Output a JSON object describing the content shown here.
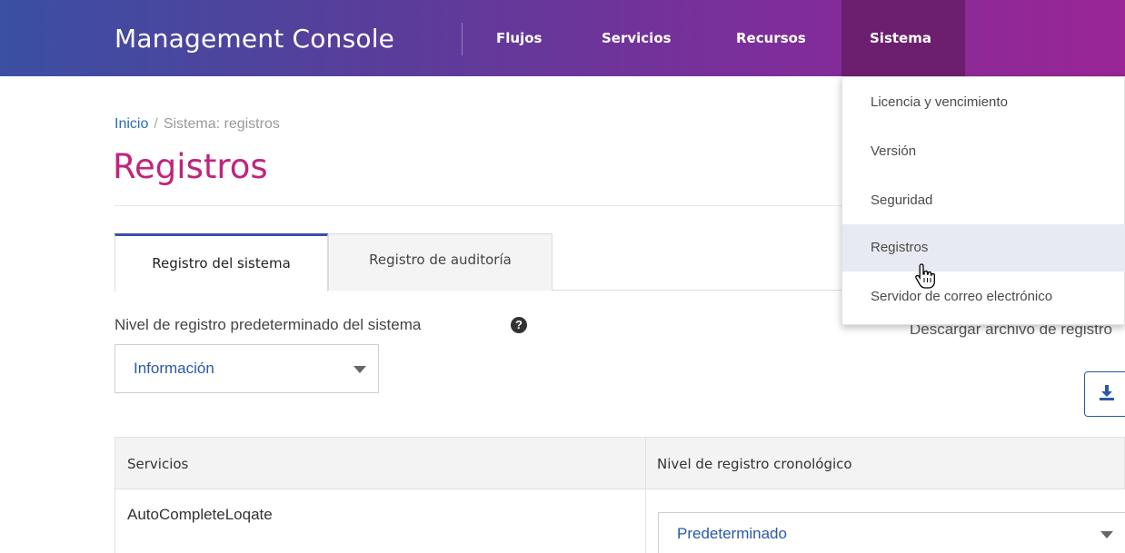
{
  "header": {
    "brand": "Management Console",
    "nav": {
      "flujos": "Flujos",
      "servicios": "Servicios",
      "recursos": "Recursos",
      "sistema": "Sistema"
    }
  },
  "dropdown": {
    "items": [
      {
        "label": "Licencia y vencimiento"
      },
      {
        "label": "Versión"
      },
      {
        "label": "Seguridad"
      },
      {
        "label": "Registros"
      },
      {
        "label": "Servidor de correo electrónico"
      }
    ],
    "active_item": "Registros"
  },
  "breadcrumb": {
    "home": "Inicio",
    "separator": "/",
    "current": "Sistema: registros"
  },
  "page": {
    "title": "Registros"
  },
  "tabs": {
    "system": "Registro del sistema",
    "audit": "Registro de auditoría"
  },
  "log_level": {
    "label": "Nivel de registro predeterminado del sistema",
    "help_icon": "question-circle-icon",
    "selected": "Información"
  },
  "download": {
    "label": "Descargar archivo de registro",
    "icon": "download-icon"
  },
  "table": {
    "headers": {
      "services": "Servicios",
      "level": "Nivel de registro cronológico"
    },
    "rows": [
      {
        "service": "AutoCompleteLoqate",
        "level": "Predeterminado"
      }
    ]
  },
  "colors": {
    "header_gradient_start": "#3b4fa3",
    "header_gradient_end": "#9b2596",
    "nav_active": "#6b1f6e",
    "title": "#c0247d",
    "link": "#2a6db5",
    "tab_active_border": "#3a4faa"
  }
}
